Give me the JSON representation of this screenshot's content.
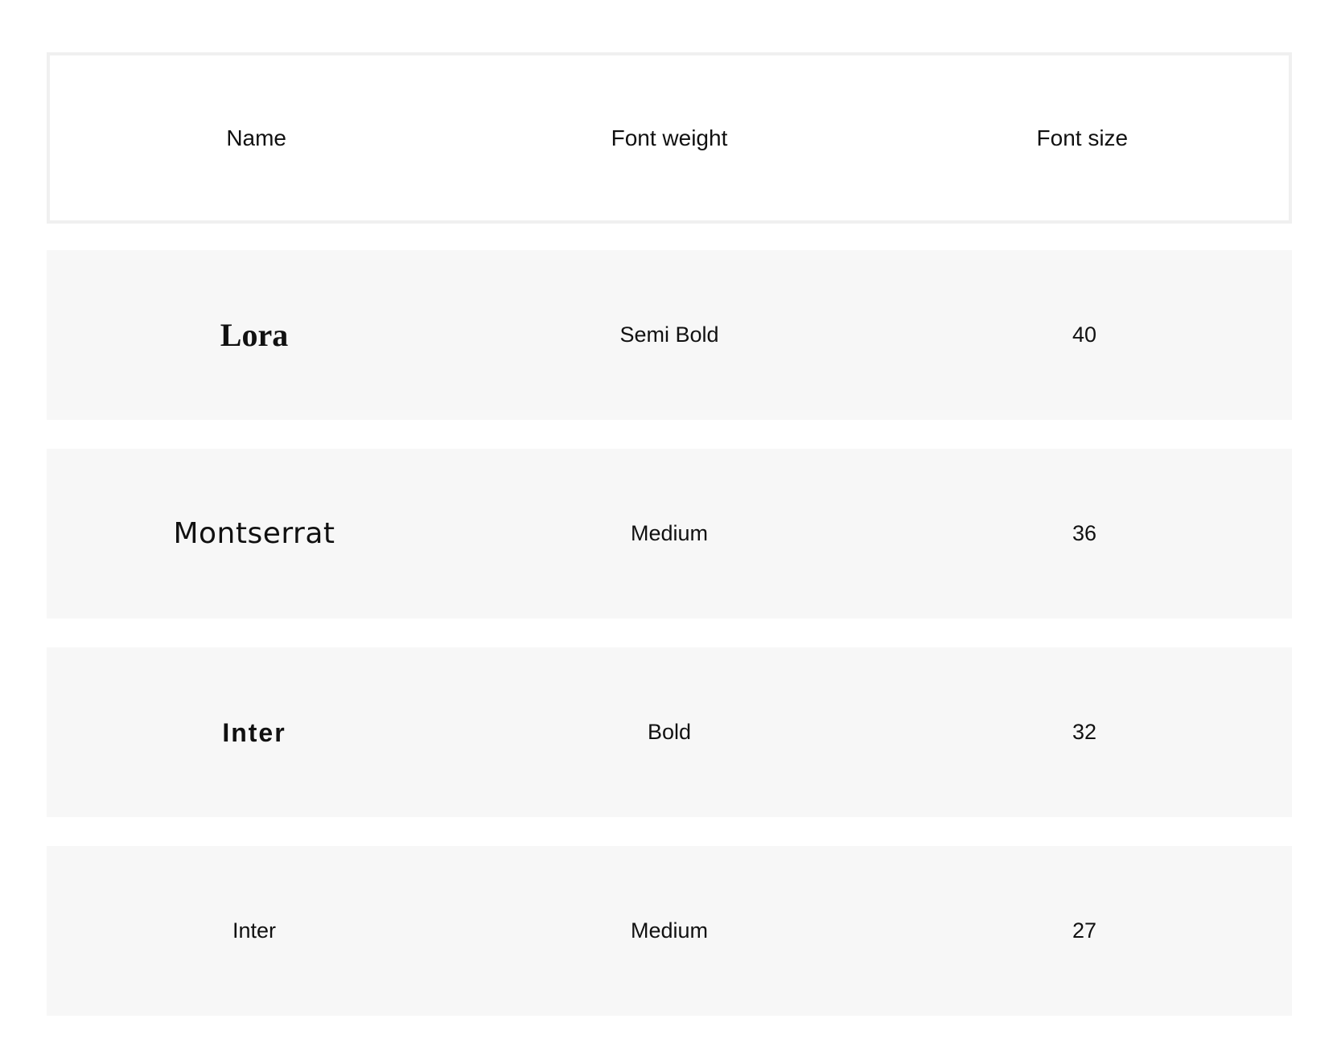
{
  "table": {
    "headers": [
      "Name",
      "Font weight",
      "Font size"
    ],
    "rows": [
      {
        "name": "Lora",
        "weight": "Semi Bold",
        "size": "40"
      },
      {
        "name": "Montserrat",
        "weight": "Medium",
        "size": "36"
      },
      {
        "name": "Inter",
        "weight": "Bold",
        "size": "32"
      },
      {
        "name": "Inter",
        "weight": "Medium",
        "size": "27"
      }
    ]
  }
}
